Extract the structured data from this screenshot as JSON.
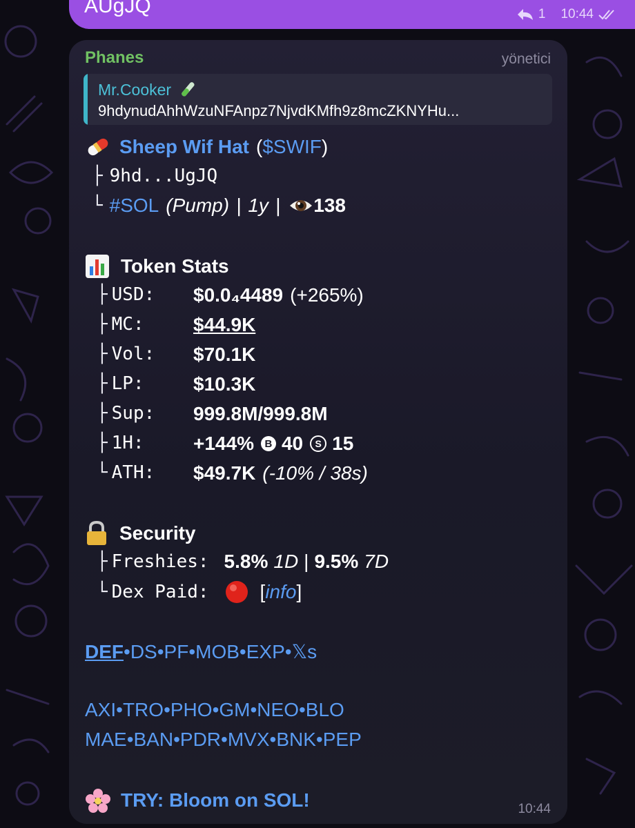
{
  "outgoing": {
    "text": "AUgJQ",
    "reply_count": "1",
    "time": "10:44"
  },
  "message": {
    "sender": "Phanes",
    "role": "yönetici",
    "reply": {
      "name": "Mr.Cooker",
      "emoji": "test-tube-icon",
      "text": "9hdynudAhhWzuNFAnpz7NjvdKMfh9z8mcZKNYHu..."
    },
    "token": {
      "emoji": "pill-icon",
      "name": "Sheep Wif Hat",
      "open_paren": "(",
      "ticker": "$SWIF",
      "close_paren": ")",
      "addr_prefix": "├",
      "address": "9hd...UgJQ",
      "meta_prefix": "└",
      "chain": "#SOL",
      "platform": "(Pump)",
      "sep1": "|",
      "age": "1y",
      "sep2": "|",
      "views_icon": "eye-icon",
      "views": "138"
    },
    "stats": {
      "emoji": "bar-chart-icon",
      "title": "Token Stats",
      "rows": [
        {
          "prefix": "├",
          "label": "USD:",
          "value": "$0.0₄4489",
          "extra": "(+265%)"
        },
        {
          "prefix": "├",
          "label": "MC:",
          "value": "$44.9K"
        },
        {
          "prefix": "├",
          "label": "Vol:",
          "value": "$70.1K"
        },
        {
          "prefix": "├",
          "label": "LP:",
          "value": "$10.3K"
        },
        {
          "prefix": "├",
          "label": "Sup:",
          "value": "999.8M/999.8M"
        },
        {
          "prefix": "├",
          "label": "1H:",
          "value": "+144%",
          "b_icon": "B",
          "b_value": "40",
          "s_icon": "S",
          "s_value": "15"
        },
        {
          "prefix": "└",
          "label": "ATH:",
          "value": "$49.7K",
          "extra": "(-10% / 38s)"
        }
      ]
    },
    "security": {
      "emoji": "lock-icon",
      "title": "Security",
      "freshies_prefix": "├",
      "freshies_label": "Freshies:",
      "freshies_1d": "5.8%",
      "freshies_1d_unit": "1D",
      "freshies_sep": "|",
      "freshies_7d": "9.5%",
      "freshies_7d_unit": "7D",
      "dex_prefix": "└",
      "dex_label": "Dex Paid:",
      "dex_status_icon": "red-circle-icon",
      "dex_open": "[",
      "dex_info": "info",
      "dex_close": "]"
    },
    "links_row1": [
      "DEF",
      "DS",
      "PF",
      "MOB",
      "EXP",
      "𝕏s"
    ],
    "links_row2": [
      "AXI",
      "TRO",
      "PHO",
      "GM",
      "NEO",
      "BLO"
    ],
    "links_row3": [
      "MAE",
      "BAN",
      "PDR",
      "MVX",
      "BNK",
      "PEP"
    ],
    "link_sep": "•",
    "promo": {
      "emoji": "cherry-blossom-icon",
      "text": "TRY: Bloom on SOL!"
    },
    "time": "10:44"
  },
  "colors": {
    "outgoing_bubble": "#9a4fe3",
    "incoming_bubble": "#1f1d2e",
    "sender": "#71c163",
    "link": "#5b9cf2",
    "reply_bar": "#3fb5c9"
  }
}
